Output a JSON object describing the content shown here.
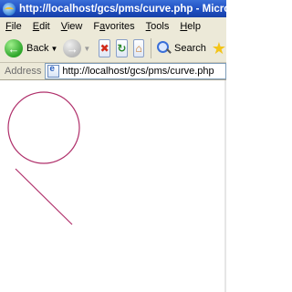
{
  "window": {
    "title": "http://localhost/gcs/pms/curve.php - Microsoft Internet Explorer"
  },
  "menu": {
    "items": [
      {
        "key": "F",
        "rest": "ile"
      },
      {
        "key": "E",
        "rest": "dit"
      },
      {
        "key": "V",
        "rest": "iew"
      },
      {
        "key": "",
        "rest": "Favorites",
        "underline_index": 1
      },
      {
        "key": "T",
        "rest": "ools"
      },
      {
        "key": "H",
        "rest": "elp"
      }
    ]
  },
  "toolbar": {
    "back_label": "Back",
    "search_label": "Search",
    "icons": [
      "back-arrow-icon",
      "forward-arrow-icon",
      "stop-icon",
      "refresh-icon",
      "home-icon",
      "search-icon",
      "favorites-star-icon"
    ]
  },
  "address": {
    "label": "Address",
    "url": "http://localhost/gcs/pms/curve.php"
  },
  "drawing": {
    "stroke_color": "#b0306b",
    "shapes": [
      "circle",
      "line"
    ]
  }
}
